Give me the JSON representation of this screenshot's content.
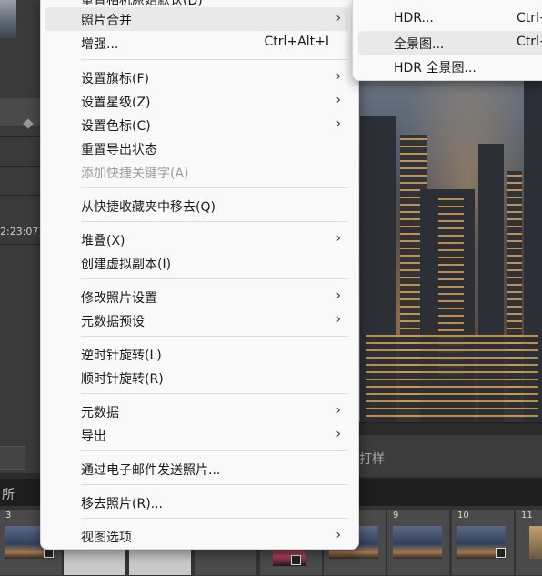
{
  "background": {
    "timestamp": "2:23:07)",
    "toolbar_text": "打样",
    "filmstrip_label": "所",
    "filmstrip_numbers": [
      "3",
      "9",
      "10",
      "11"
    ]
  },
  "context_menu": {
    "cut_top_item": "重置相机原始默认(D)",
    "items": [
      {
        "label": "照片合并",
        "submenu": true,
        "highlighted": true
      },
      {
        "label": "增强...",
        "shortcut": "Ctrl+Alt+I"
      },
      {
        "label": "设置旗标(F)",
        "submenu": true
      },
      {
        "label": "设置星级(Z)",
        "submenu": true
      },
      {
        "label": "设置色标(C)",
        "submenu": true
      },
      {
        "label": "重置导出状态"
      },
      {
        "label": "添加快捷关键字(A)",
        "disabled": true
      },
      {
        "label": "从快捷收藏夹中移去(Q)"
      },
      {
        "label": "堆叠(X)",
        "submenu": true
      },
      {
        "label": "创建虚拟副本(I)"
      },
      {
        "label": "修改照片设置",
        "submenu": true
      },
      {
        "label": "元数据预设",
        "submenu": true
      },
      {
        "label": "逆时针旋转(L)"
      },
      {
        "label": "顺时针旋转(R)"
      },
      {
        "label": "元数据",
        "submenu": true
      },
      {
        "label": "导出",
        "submenu": true
      },
      {
        "label": "通过电子邮件发送照片..."
      },
      {
        "label": "移去照片(R)..."
      },
      {
        "label": "视图选项",
        "submenu": true
      }
    ],
    "arrow_glyph": "›"
  },
  "submenu": {
    "items": [
      {
        "label": "HDR...",
        "shortcut": "Ctrl+"
      },
      {
        "label": "全景图...",
        "shortcut": "Ctrl+",
        "highlighted": true
      },
      {
        "label": "HDR 全景图..."
      }
    ]
  }
}
